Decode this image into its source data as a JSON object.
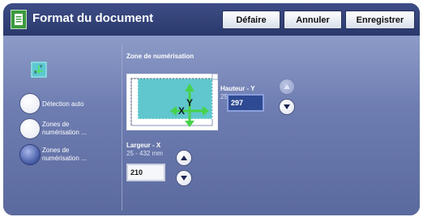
{
  "header": {
    "title": "Format du document",
    "buttons": {
      "undo": "Défaire",
      "cancel": "Annuler",
      "save": "Enregistrer"
    }
  },
  "options": [
    {
      "label": "Détection auto",
      "selected": false
    },
    {
      "label": "Zones de\nnumérisation ...",
      "selected": false
    },
    {
      "label": "Zones de\nnumérisation ...",
      "selected": true
    }
  ],
  "scan_area": {
    "title": "Zone de numérisation",
    "x_marker": "X",
    "y_marker": "Y"
  },
  "width": {
    "label": "Largeur - X",
    "range": "25 - 432 mm",
    "value": "210"
  },
  "height": {
    "label": "Hauteur - Y",
    "range": "25 - 297 mm",
    "value": "297"
  },
  "icons": [
    "document-format-icon",
    "scan-area-icon",
    "arrow-up-icon",
    "arrow-down-icon"
  ],
  "colors": {
    "accent": "#2d4a93",
    "header": "#2a396c",
    "panel": "#6e7db1",
    "marker_green": "#47d24a"
  }
}
